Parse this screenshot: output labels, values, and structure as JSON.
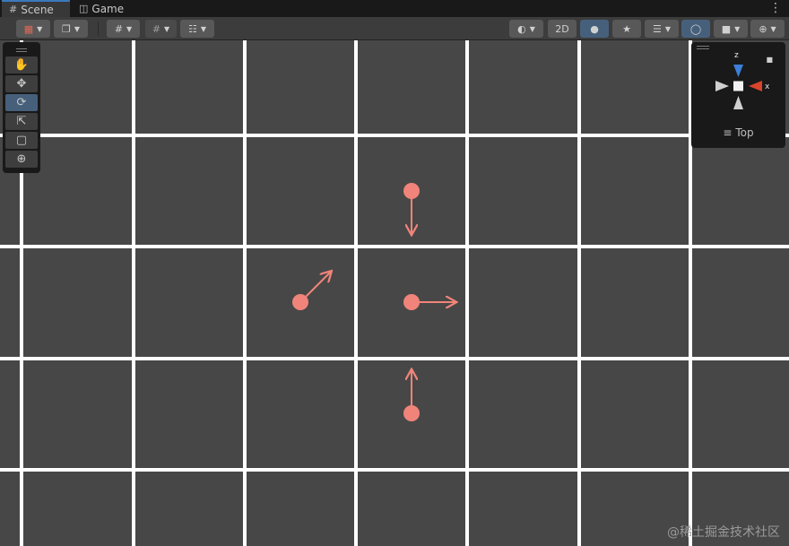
{
  "tabs": [
    {
      "label": "Scene",
      "icon": "grid-icon",
      "active": true
    },
    {
      "label": "Game",
      "icon": "gamepad-icon",
      "active": false
    }
  ],
  "toolbar": {
    "two_d_label": "2D"
  },
  "tools": [
    {
      "name": "hand-tool",
      "icon": "hand-icon",
      "active": false
    },
    {
      "name": "move-tool",
      "icon": "move-icon",
      "active": false
    },
    {
      "name": "rotate-tool",
      "icon": "rotate-icon",
      "active": true
    },
    {
      "name": "scale-tool",
      "icon": "scale-icon",
      "active": false
    },
    {
      "name": "rect-tool",
      "icon": "rect-icon",
      "active": false
    },
    {
      "name": "transform-tool",
      "icon": "transform-icon",
      "active": false
    }
  ],
  "gizmo": {
    "axis_z": "z",
    "axis_x": "x",
    "view_label": "Top",
    "z_color": "#3d7fd8",
    "x_color": "#d8442c"
  },
  "scene": {
    "background": "#474747",
    "grid_color": "#ffffff",
    "marker_color": "#f0847a"
  },
  "watermark": "@稀土掘金技术社区"
}
